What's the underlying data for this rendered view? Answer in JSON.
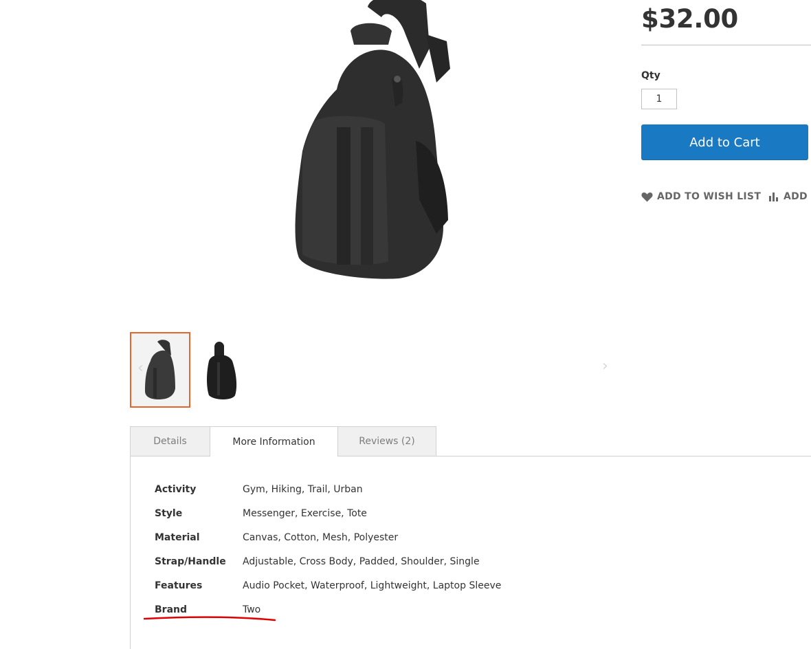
{
  "product": {
    "price": "$32.00",
    "qty_label": "Qty",
    "qty_value": "1",
    "add_to_cart": "Add to Cart",
    "wish_list": "Add to Wish List",
    "compare": "Add t"
  },
  "gallery": {
    "thumbnail_count": 2,
    "selected_index": 0,
    "prev_icon": "chevron-left-icon",
    "next_icon": "chevron-right-icon"
  },
  "tabs": [
    {
      "label": "Details"
    },
    {
      "label": "More Information"
    },
    {
      "label": "Reviews (2)"
    }
  ],
  "more_info": [
    {
      "label": "Activity",
      "value": "Gym, Hiking, Trail, Urban"
    },
    {
      "label": "Style",
      "value": "Messenger, Exercise, Tote"
    },
    {
      "label": "Material",
      "value": "Canvas, Cotton, Mesh, Polyester"
    },
    {
      "label": "Strap/Handle",
      "value": "Adjustable, Cross Body, Padded, Shoulder, Single"
    },
    {
      "label": "Features",
      "value": "Audio Pocket, Waterproof, Lightweight, Laptop Sleeve"
    },
    {
      "label": "Brand",
      "value": "Two"
    }
  ],
  "colors": {
    "accent": "#1979c3",
    "thumb_selected": "#e8642f",
    "annotation": "#e00000"
  }
}
